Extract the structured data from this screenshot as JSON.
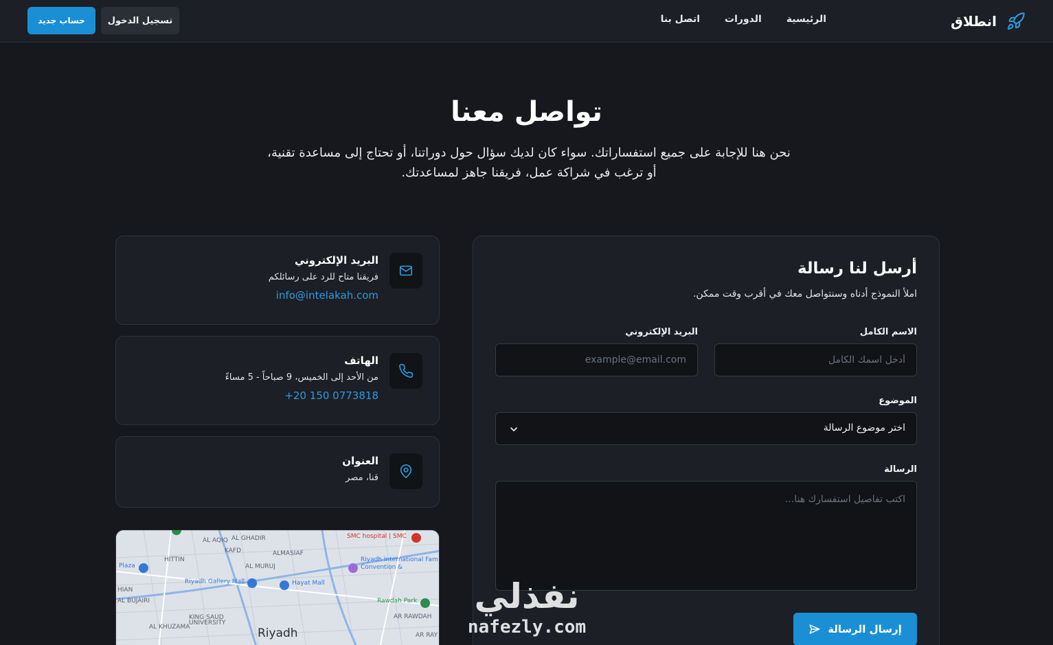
{
  "nav": {
    "brand": "انطلاق",
    "links": [
      "الرئيسية",
      "الدورات",
      "اتصل بنا"
    ],
    "login": "تسجيل الدخول",
    "register": "حساب جديد"
  },
  "hero": {
    "title": "تواصل معنا",
    "subtitle": "نحن هنا للإجابة على جميع استفساراتك. سواء كان لديك سؤال حول دوراتنا، أو تحتاج إلى مساعدة تقنية، أو ترغب في شراكة عمل، فريقنا جاهز لمساعدتك."
  },
  "info": {
    "email": {
      "title": "البريد الإلكتروني",
      "desc": "فريقنا متاح للرد على رسائلكم",
      "value": "info@intelakah.com",
      "icon": "mail-icon"
    },
    "phone": {
      "title": "الهاتف",
      "desc": "من الأحد إلى الخميس، 9 صباحاً - 5 مساءً",
      "value": "+20 150 0773818",
      "icon": "phone-icon"
    },
    "address": {
      "title": "العنوان",
      "desc": "قنا، مصر",
      "icon": "map-pin-icon"
    }
  },
  "map": {
    "city": "Riyadh",
    "labels": [
      "AL AQIQ",
      "AL GHADIR",
      "SMC hospital | SMC",
      "HITTIN",
      "KAFD",
      "ALMASIAF",
      "AL MURUJ",
      "Riyadh International Fam",
      "Convention &",
      "Plaza",
      "Riyadh Gallery Mall",
      "Hayat Mall",
      "HIAN",
      "AL BUJAIRI",
      "Rawdah Park",
      "AR RAWDAH",
      "KING SAUD",
      "UNIVERSITY",
      "AL KHUZAMA",
      "AR RAY"
    ]
  },
  "form": {
    "title": "أرسل لنا رسالة",
    "subtitle": "املأ النموذج أدناه وسنتواصل معك في أقرب وقت ممكن.",
    "name_label": "الاسم الكامل",
    "name_placeholder": "أدخل اسمك الكامل",
    "email_label": "البريد الإلكتروني",
    "email_placeholder": "example@email.com",
    "subject_label": "الموضوع",
    "subject_value": "اختر موضوع الرسالة",
    "message_label": "الرسالة",
    "message_placeholder": "اكتب تفاصيل استفسارك هنا...",
    "submit": "إرسال الرسالة"
  },
  "watermark": {
    "ar": "نفذلي",
    "en": "nafezly.com"
  },
  "colors": {
    "accent": "#1a8fd6",
    "background": "#16181d",
    "card": "#1c1f25"
  }
}
